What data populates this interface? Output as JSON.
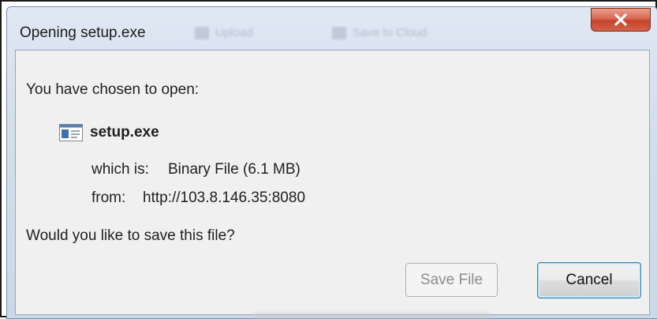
{
  "window": {
    "title": "Opening setup.exe",
    "background_toolbar": [
      "Upload",
      "Save to Cloud"
    ]
  },
  "dialog": {
    "prompt": "You have chosen to open:",
    "file_name": "setup.exe",
    "type_label": "which is:",
    "type_value": "Binary File (6.1 MB)",
    "from_label": "from:",
    "from_value": "http://103.8.146.35:8080",
    "question": "Would you like to save this file?"
  },
  "buttons": {
    "save_label": "Save File",
    "cancel_label": "Cancel"
  },
  "colors": {
    "close_button": "#c6422a",
    "cancel_focus_border": "#3c7fb1",
    "dialog_background": "#f0f0f0"
  },
  "icons": {
    "close": "close-icon",
    "file": "exe-file-icon"
  }
}
